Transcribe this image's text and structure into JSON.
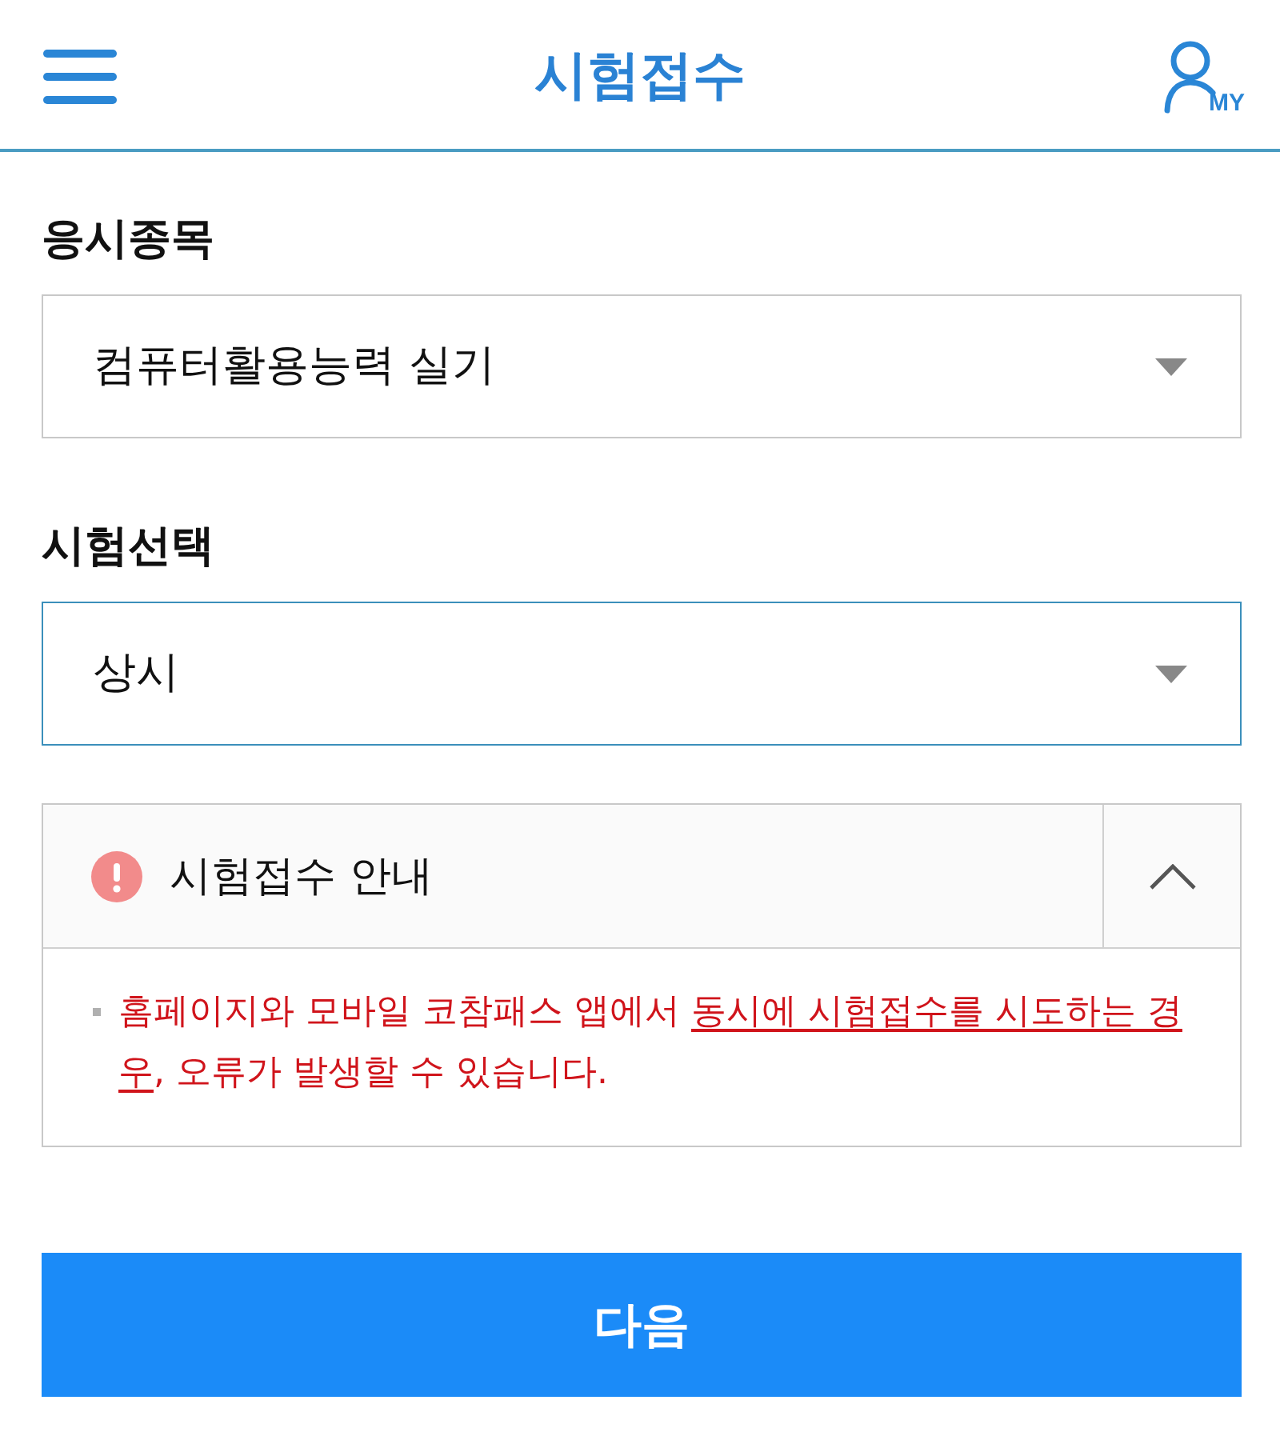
{
  "header": {
    "title": "시험접수",
    "my_button": "MY"
  },
  "fields": [
    {
      "label": "응시종목",
      "value": "컴퓨터활용능력 실기",
      "focused": false
    },
    {
      "label": "시험선택",
      "value": "상시",
      "focused": true
    }
  ],
  "notice": {
    "title": "시험접수 안내",
    "expanded": true,
    "items": [
      {
        "segments": [
          {
            "text": "홈페이지와 모바일 코참패스 앱에서 ",
            "underline": false
          },
          {
            "text": "동시에 시험접수를 시도하는 경우",
            "underline": true
          },
          {
            "text": ", 오류가 발생할 수 있습니다.",
            "underline": false
          }
        ]
      }
    ]
  },
  "next_button": "다음"
}
